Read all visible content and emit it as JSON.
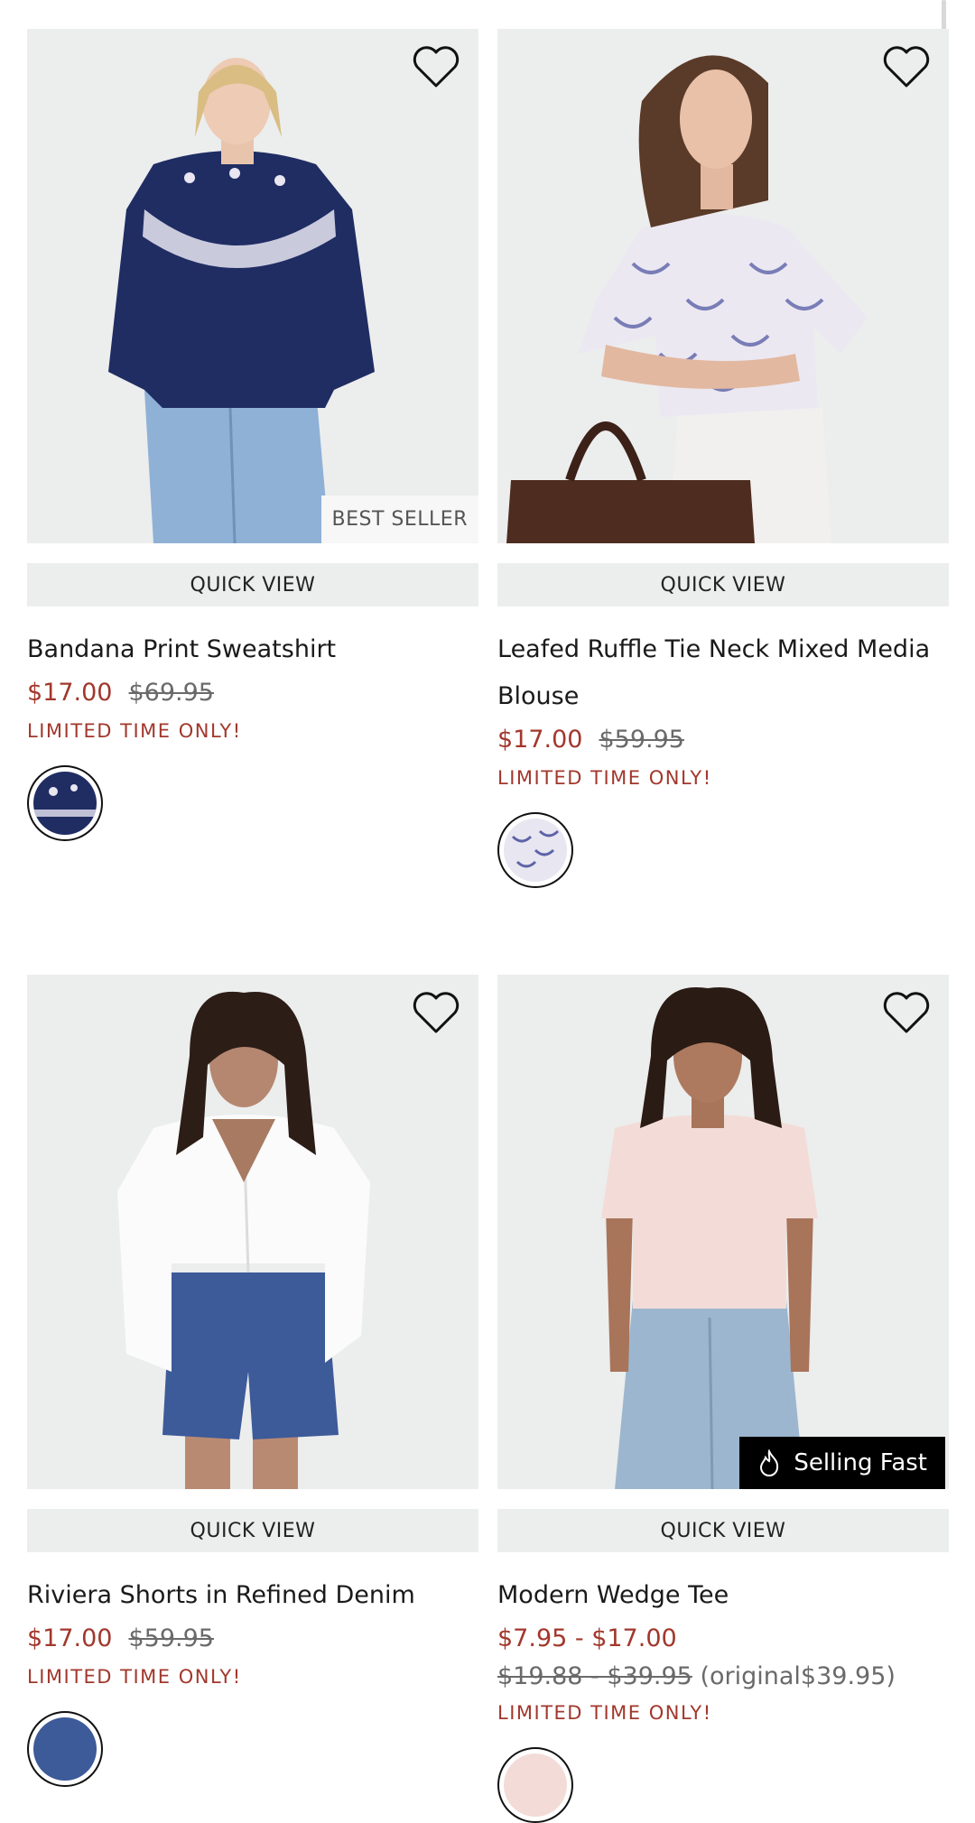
{
  "products": [
    {
      "name": "Bandana Print Sweatshirt",
      "sale_price": "$17.00",
      "original_price": "$69.95",
      "promo": "LIMITED TIME ONLY!",
      "badge": "BEST SELLER",
      "quick_view": "QUICK VIEW",
      "swatch_color": "#1f2d63"
    },
    {
      "name": "Leafed Ruffle Tie Neck Mixed Media Blouse",
      "sale_price": "$17.00",
      "original_price": "$59.95",
      "promo": "LIMITED TIME ONLY!",
      "quick_view": "QUICK VIEW",
      "swatch_color": "#e8e6f0"
    },
    {
      "name": "Riviera Shorts in Refined Denim",
      "sale_price": "$17.00",
      "original_price": "$59.95",
      "promo": "LIMITED TIME ONLY!",
      "quick_view": "QUICK VIEW",
      "swatch_color": "#3d5a99"
    },
    {
      "name": "Modern Wedge Tee",
      "sale_price": "$7.95 - $17.00",
      "original_range": "$19.88 - $39.95",
      "original_note": "(original$39.95)",
      "promo": "LIMITED TIME ONLY!",
      "badge": "Selling Fast",
      "quick_view": "QUICK VIEW"
    }
  ],
  "icons": {
    "wishlist": "heart-outline-icon",
    "selling_fast": "flame-icon"
  },
  "colors": {
    "sale": "#a2372c",
    "image_bg": "#eceded"
  }
}
